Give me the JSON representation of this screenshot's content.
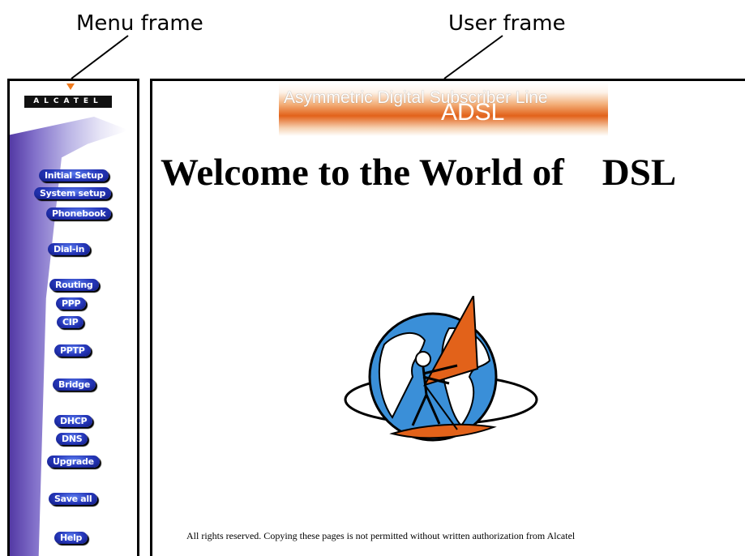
{
  "callouts": {
    "menu": "Menu frame",
    "user": "User frame"
  },
  "menu": {
    "logo": "ALCATEL",
    "buttons": [
      "Initial Setup",
      "System setup",
      "Phonebook",
      "Dial-in",
      "Routing",
      "PPP",
      "CIP",
      "PPTP",
      "Bridge",
      "DHCP",
      "DNS",
      "Upgrade",
      "Save all",
      "Help"
    ]
  },
  "user": {
    "banner_sub": "Asymmetric Digital Subscriber Line",
    "banner_main": "ADSL",
    "welcome": "Welcome to the World of    DSL",
    "footer": "All rights reserved. Copying these pages is not permitted without written authorization from Alcatel"
  },
  "colors": {
    "button": "#2536b8",
    "accent_orange": "#e2621a",
    "globe_blue": "#3a8fd8"
  }
}
